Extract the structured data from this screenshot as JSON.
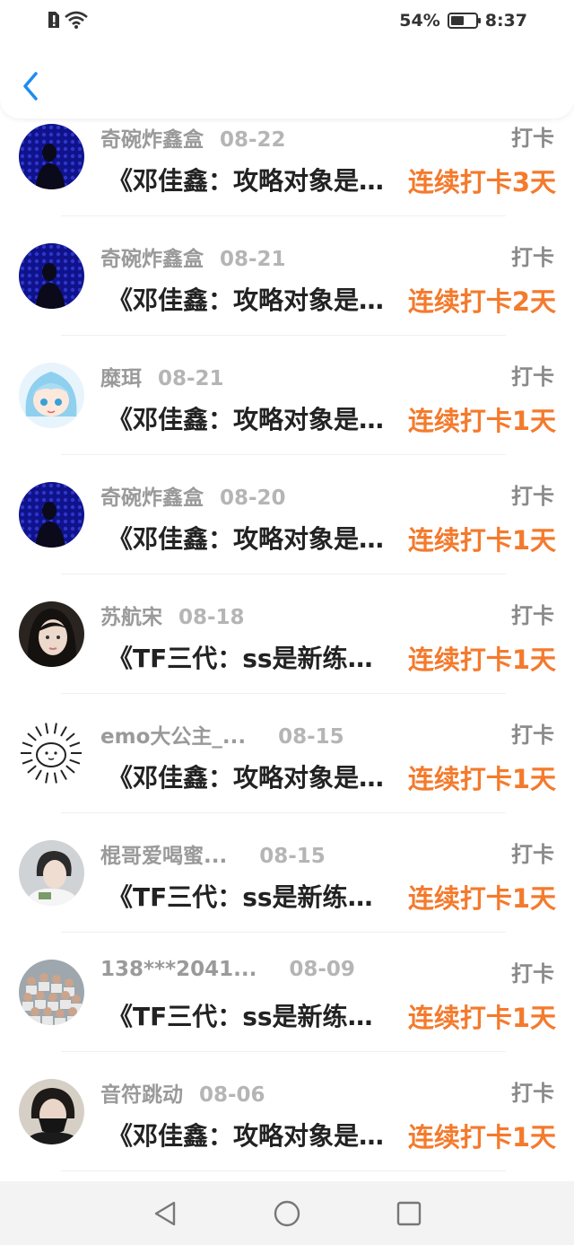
{
  "status": {
    "battery_text": "54%",
    "battery_level": 0.54,
    "time": "8:37"
  },
  "header": {
    "back_icon": "chevron-left-icon",
    "accent": "#1e8cf0"
  },
  "colors": {
    "streak": "#f47a2c"
  },
  "items": [
    {
      "name": "奇碗炸鑫盒",
      "date": "08-22",
      "tag": "打卡",
      "title": "《邓佳鑫：攻略对象是野王哥哥》",
      "streak": "连续打卡3天",
      "avatar": "dark-blue"
    },
    {
      "name": "奇碗炸鑫盒",
      "date": "08-21",
      "tag": "打卡",
      "title": "《邓佳鑫：攻略对象是野王哥哥》",
      "streak": "连续打卡2天",
      "avatar": "dark-blue"
    },
    {
      "name": "糜珥",
      "date": "08-21",
      "tag": "打卡",
      "title": "《邓佳鑫：攻略对象是野王哥哥》",
      "streak": "连续打卡1天",
      "avatar": "anime"
    },
    {
      "name": "奇碗炸鑫盒",
      "date": "08-20",
      "tag": "打卡",
      "title": "《邓佳鑫：攻略对象是野王哥哥》",
      "streak": "连续打卡1天",
      "avatar": "dark-blue"
    },
    {
      "name": "苏航宋",
      "date": "08-18",
      "tag": "打卡",
      "title": "《TF三代：ss是新练习生》",
      "streak": "连续打卡1天",
      "avatar": "portrait"
    },
    {
      "name": "emo大公主_...",
      "date": "08-15",
      "tag": "打卡",
      "title": "《邓佳鑫：攻略对象是野王哥哥》",
      "streak": "连续打卡1天",
      "avatar": "doodle"
    },
    {
      "name": "棍哥爱喝蜜...",
      "date": "08-15",
      "tag": "打卡",
      "title": "《TF三代：ss是新练习生》",
      "streak": "连续打卡1天",
      "avatar": "photo"
    },
    {
      "name": "138***2041...",
      "date": "08-09",
      "tag": "打卡",
      "title": "《TF三代：ss是新练习生》",
      "streak": "连续打卡1天",
      "avatar": "group"
    },
    {
      "name": "音符跳动",
      "date": "08-06",
      "tag": "打卡",
      "title": "《邓佳鑫：攻略对象是野王哥哥》",
      "streak": "连续打卡1天",
      "avatar": "masked"
    }
  ],
  "nav": {
    "back": "triangle-back-icon",
    "home": "circle-home-icon",
    "recents": "square-recents-icon"
  }
}
